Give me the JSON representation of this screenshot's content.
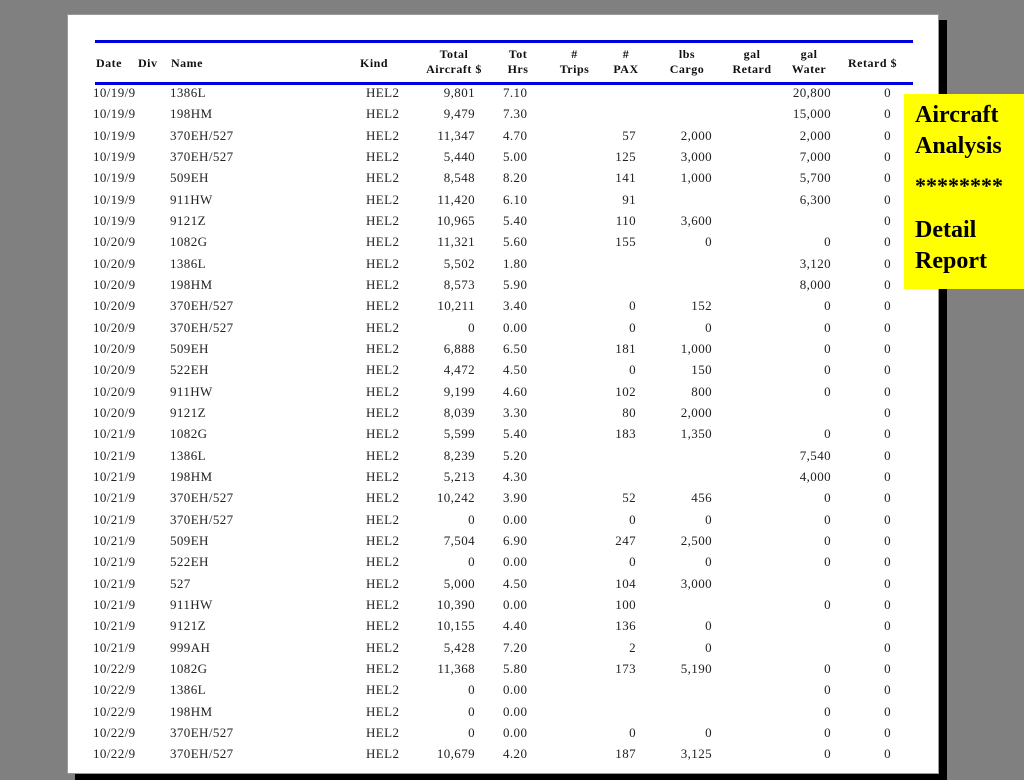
{
  "headers": {
    "date": "Date",
    "div": "Div",
    "name": "Name",
    "kind": "Kind",
    "total_1": "Total",
    "total_2": "Aircraft $",
    "hrs_1": "Tot",
    "hrs_2": "Hrs",
    "trips_1": "#",
    "trips_2": "Trips",
    "pax_1": "#",
    "pax_2": "PAX",
    "cargo_1": "lbs",
    "cargo_2": "Cargo",
    "retard_1": "gal",
    "retard_2": "Retard",
    "water_1": "gal",
    "water_2": "Water",
    "retard_cost": "Retard $"
  },
  "rows": [
    [
      "10/19/9",
      "1386L",
      "HEL2",
      "9,801",
      "7.10",
      "",
      "",
      "20,800",
      "0"
    ],
    [
      "10/19/9",
      "198HM",
      "HEL2",
      "9,479",
      "7.30",
      "",
      "",
      "15,000",
      "0"
    ],
    [
      "10/19/9",
      "370EH/527",
      "HEL2",
      "11,347",
      "4.70",
      "57",
      "2,000",
      "2,000",
      "0"
    ],
    [
      "10/19/9",
      "370EH/527",
      "HEL2",
      "5,440",
      "5.00",
      "125",
      "3,000",
      "7,000",
      "0"
    ],
    [
      "10/19/9",
      "509EH",
      "HEL2",
      "8,548",
      "8.20",
      "141",
      "1,000",
      "5,700",
      "0"
    ],
    [
      "10/19/9",
      "911HW",
      "HEL2",
      "11,420",
      "6.10",
      "91",
      "",
      "6,300",
      "0"
    ],
    [
      "10/19/9",
      "9121Z",
      "HEL2",
      "10,965",
      "5.40",
      "110",
      "3,600",
      "",
      "0"
    ],
    [
      "10/20/9",
      "1082G",
      "HEL2",
      "11,321",
      "5.60",
      "155",
      "0",
      "0",
      "0"
    ],
    [
      "10/20/9",
      "1386L",
      "HEL2",
      "5,502",
      "1.80",
      "",
      "",
      "3,120",
      "0"
    ],
    [
      "10/20/9",
      "198HM",
      "HEL2",
      "8,573",
      "5.90",
      "",
      "",
      "8,000",
      "0"
    ],
    [
      "10/20/9",
      "370EH/527",
      "HEL2",
      "10,211",
      "3.40",
      "0",
      "152",
      "0",
      "0"
    ],
    [
      "10/20/9",
      "370EH/527",
      "HEL2",
      "0",
      "0.00",
      "0",
      "0",
      "0",
      "0"
    ],
    [
      "10/20/9",
      "509EH",
      "HEL2",
      "6,888",
      "6.50",
      "181",
      "1,000",
      "0",
      "0"
    ],
    [
      "10/20/9",
      "522EH",
      "HEL2",
      "4,472",
      "4.50",
      "0",
      "150",
      "0",
      "0"
    ],
    [
      "10/20/9",
      "911HW",
      "HEL2",
      "9,199",
      "4.60",
      "102",
      "800",
      "0",
      "0"
    ],
    [
      "10/20/9",
      "9121Z",
      "HEL2",
      "8,039",
      "3.30",
      "80",
      "2,000",
      "",
      "0"
    ],
    [
      "10/21/9",
      "1082G",
      "HEL2",
      "5,599",
      "5.40",
      "183",
      "1,350",
      "0",
      "0"
    ],
    [
      "10/21/9",
      "1386L",
      "HEL2",
      "8,239",
      "5.20",
      "",
      "",
      "7,540",
      "0"
    ],
    [
      "10/21/9",
      "198HM",
      "HEL2",
      "5,213",
      "4.30",
      "",
      "",
      "4,000",
      "0"
    ],
    [
      "10/21/9",
      "370EH/527",
      "HEL2",
      "10,242",
      "3.90",
      "52",
      "456",
      "0",
      "0"
    ],
    [
      "10/21/9",
      "370EH/527",
      "HEL2",
      "0",
      "0.00",
      "0",
      "0",
      "0",
      "0"
    ],
    [
      "10/21/9",
      "509EH",
      "HEL2",
      "7,504",
      "6.90",
      "247",
      "2,500",
      "0",
      "0"
    ],
    [
      "10/21/9",
      "522EH",
      "HEL2",
      "0",
      "0.00",
      "0",
      "0",
      "0",
      "0"
    ],
    [
      "10/21/9",
      "527",
      "HEL2",
      "5,000",
      "4.50",
      "104",
      "3,000",
      "",
      "0"
    ],
    [
      "10/21/9",
      "911HW",
      "HEL2",
      "10,390",
      "0.00",
      "100",
      "",
      "0",
      "0"
    ],
    [
      "10/21/9",
      "9121Z",
      "HEL2",
      "10,155",
      "4.40",
      "136",
      "0",
      "",
      "0"
    ],
    [
      "10/21/9",
      "999AH",
      "HEL2",
      "5,428",
      "7.20",
      "2",
      "0",
      "",
      "0"
    ],
    [
      "10/22/9",
      "1082G",
      "HEL2",
      "11,368",
      "5.80",
      "173",
      "5,190",
      "0",
      "0"
    ],
    [
      "10/22/9",
      "1386L",
      "HEL2",
      "0",
      "0.00",
      "",
      "",
      "0",
      "0"
    ],
    [
      "10/22/9",
      "198HM",
      "HEL2",
      "0",
      "0.00",
      "",
      "",
      "0",
      "0"
    ],
    [
      "10/22/9",
      "370EH/527",
      "HEL2",
      "0",
      "0.00",
      "0",
      "0",
      "0",
      "0"
    ],
    [
      "10/22/9",
      "370EH/527",
      "HEL2",
      "10,679",
      "4.20",
      "187",
      "3,125",
      "0",
      "0"
    ]
  ],
  "callout": {
    "line1": "Aircraft",
    "line2": "Analysis",
    "stars": "********",
    "line3": "Detail",
    "line4": "Report"
  }
}
